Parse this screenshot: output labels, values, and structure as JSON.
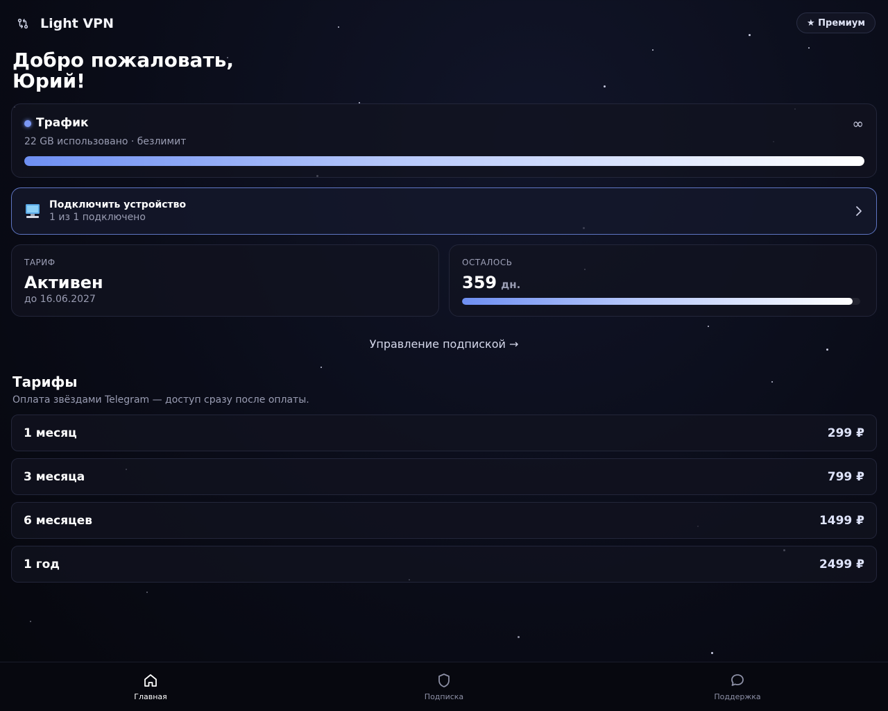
{
  "header": {
    "app_title": "Light VPN",
    "premium_label": "★ Премиум"
  },
  "welcome": {
    "line1": "Добро пожаловать,",
    "line2": "Юрий!"
  },
  "traffic": {
    "title": "Трафик",
    "subtitle": "22 GB использовано · безлимит",
    "limit_symbol": "∞",
    "progress_percent": 100
  },
  "device": {
    "title": "Подключить устройство",
    "subtitle": "1 из 1 подключено"
  },
  "plan": {
    "caption": "ТАРИФ",
    "status": "Активен",
    "until": "до 16.06.2027"
  },
  "remaining": {
    "caption": "ОСТАЛОСЬ",
    "days": "359",
    "unit": "дн.",
    "progress_percent": 98
  },
  "manage_link": "Управление подпиской →",
  "tariffs": {
    "title": "Тарифы",
    "subtitle": "Оплата звёздами Telegram — доступ сразу после оплаты.",
    "items": [
      {
        "name": "1 месяц",
        "price": "299 ₽"
      },
      {
        "name": "3 месяца",
        "price": "799 ₽"
      },
      {
        "name": "6 месяцев",
        "price": "1499 ₽"
      },
      {
        "name": "1 год",
        "price": "2499 ₽"
      }
    ]
  },
  "nav": {
    "items": [
      {
        "label": "Главная",
        "icon": "home-icon",
        "active": true
      },
      {
        "label": "Подписка",
        "icon": "shield-icon",
        "active": false
      },
      {
        "label": "Поддержка",
        "icon": "chat-bubble-icon",
        "active": false
      }
    ]
  },
  "colors": {
    "accent": "#7b98f5",
    "background": "#0a0c18",
    "border_highlight": "#5f76c4"
  }
}
